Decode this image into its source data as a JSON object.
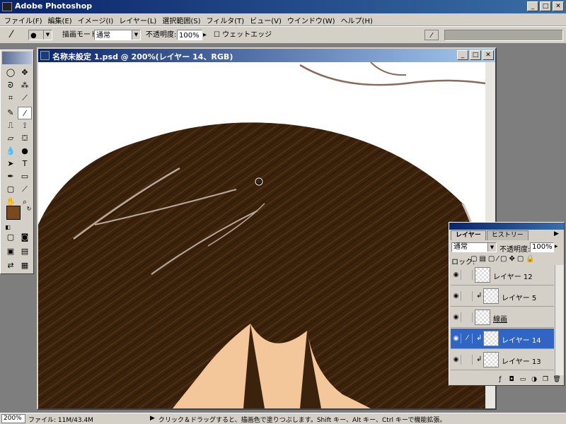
{
  "app": {
    "title": "Adobe Photoshop"
  },
  "menu": [
    "ファイル(F)",
    "編集(E)",
    "イメージ(I)",
    "レイヤー(L)",
    "選択範囲(S)",
    "フィルタ(T)",
    "ビュー(V)",
    "ウインドウ(W)",
    "ヘルプ(H)"
  ],
  "options": {
    "mode_label": "描画モード:",
    "mode_value": "通常",
    "opacity_label": "不透明度:",
    "opacity_value": "100%",
    "wet_edges_label": "ウェットエッジ"
  },
  "document": {
    "title": "名称未設定 1.psd @ 200%(レイヤー 14、RGB)"
  },
  "colors": {
    "foreground": "#7a4a1c",
    "background": "#ffffff",
    "hair": "#3a220c",
    "skin": "#f4c79a"
  },
  "layers_palette": {
    "tabs": [
      "レイヤー",
      "ヒストリー"
    ],
    "blend_mode": "通常",
    "opacity_label": "不透明度:",
    "opacity_value": "100%",
    "lock_label": "ロック:",
    "layers": [
      {
        "name": "レイヤー 12",
        "visible": true,
        "clipped": false,
        "selected": false
      },
      {
        "name": "レイヤー 5",
        "visible": true,
        "clipped": true,
        "selected": false
      },
      {
        "name": "線画",
        "visible": true,
        "clipped": false,
        "selected": false
      },
      {
        "name": "レイヤー 14",
        "visible": true,
        "clipped": true,
        "selected": true
      },
      {
        "name": "レイヤー 13",
        "visible": true,
        "clipped": true,
        "selected": false
      }
    ]
  },
  "status": {
    "zoom": "200%",
    "doc_size": "ファイル: 11M/43.4M",
    "hint": "クリック＆ドラッグすると、描画色で塗りつぶします。Shift キー、Alt キー、Ctrl キーで機能拡張。"
  }
}
